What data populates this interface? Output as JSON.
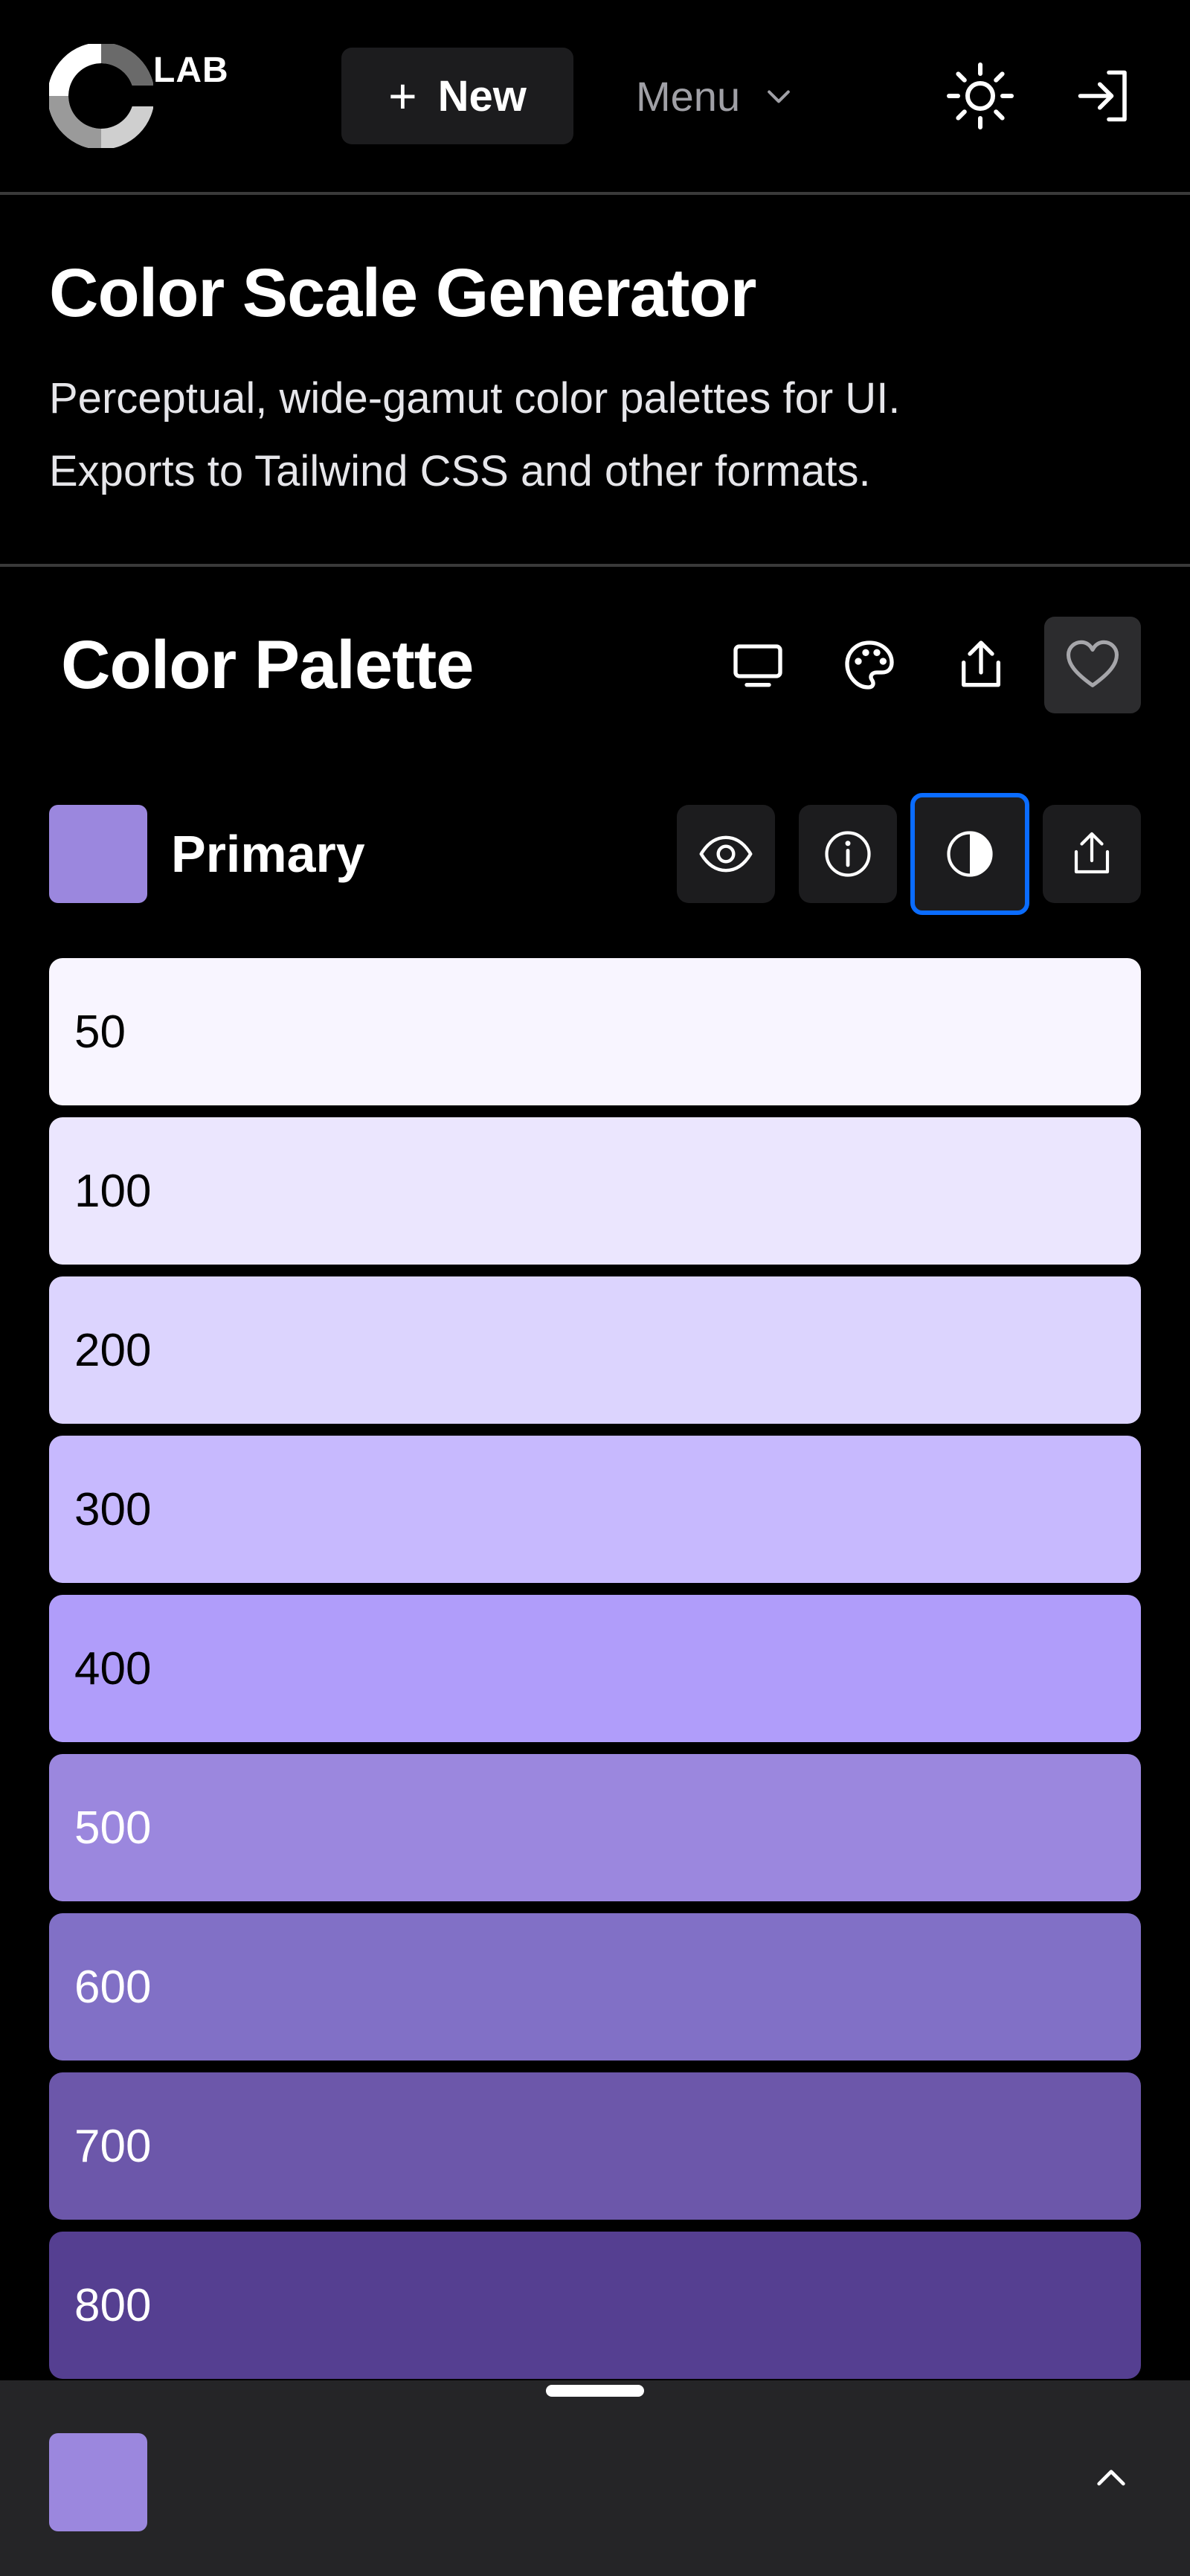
{
  "header": {
    "logo_text": "LAB",
    "new_button": {
      "icon": "plus-icon",
      "label": "New"
    },
    "menu_button": {
      "label": "Menu",
      "icon": "chevron-down-icon"
    },
    "theme_toggle_icon": "sun-icon",
    "login_icon": "sign-in-icon"
  },
  "intro": {
    "title": "Color Scale Generator",
    "description_line1": "Perceptual, wide-gamut color palettes for UI.",
    "description_line2": "Exports to Tailwind CSS and other formats."
  },
  "palette": {
    "title": "Color Palette",
    "toolbar_icons": [
      "monitor-icon",
      "palette-icon",
      "share-icon",
      "heart-icon"
    ]
  },
  "primary": {
    "label": "Primary",
    "color": "#9b87de",
    "actions": [
      "eye-icon",
      "info-icon",
      "contrast-icon",
      "share-icon"
    ]
  },
  "scale": [
    {
      "label": "50",
      "bg": "#f8f5ff",
      "fg": "#000000"
    },
    {
      "label": "100",
      "bg": "#ebe6fe",
      "fg": "#000000"
    },
    {
      "label": "200",
      "bg": "#dcd4fe",
      "fg": "#000000"
    },
    {
      "label": "300",
      "bg": "#c7b9fe",
      "fg": "#000000"
    },
    {
      "label": "400",
      "bg": "#b09dfa",
      "fg": "#000000"
    },
    {
      "label": "500",
      "bg": "#9b87de",
      "fg": "#ffffff"
    },
    {
      "label": "600",
      "bg": "#8170c6",
      "fg": "#ffffff"
    },
    {
      "label": "700",
      "bg": "#6c57aa",
      "fg": "#ffffff"
    },
    {
      "label": "800",
      "bg": "#553f91",
      "fg": "#ffffff"
    }
  ],
  "drawer": {
    "swatch_color": "#9b87de",
    "toggle_icon": "chevron-up-icon"
  }
}
